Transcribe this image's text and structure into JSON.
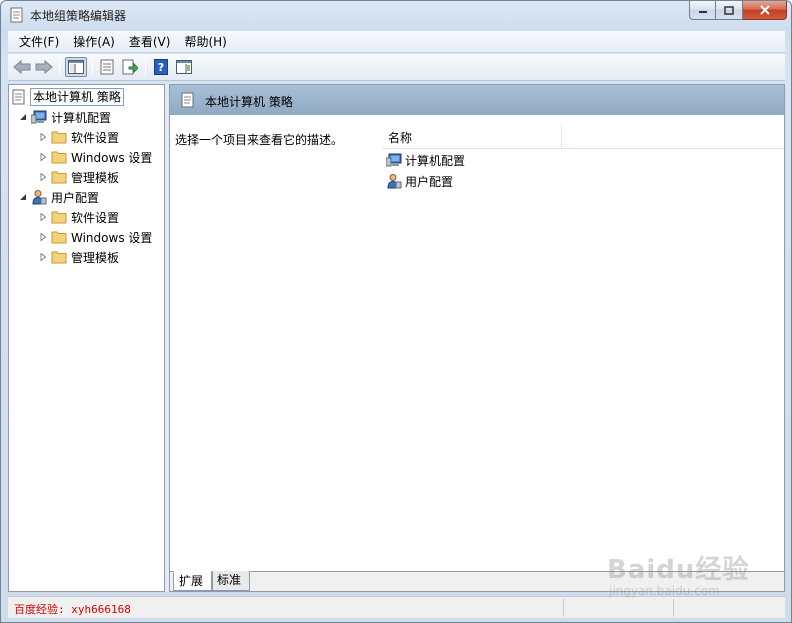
{
  "window": {
    "title": "本地组策略编辑器"
  },
  "menu": [
    {
      "label": "文件(F)"
    },
    {
      "label": "操作(A)"
    },
    {
      "label": "查看(V)"
    },
    {
      "label": "帮助(H)"
    }
  ],
  "tree": {
    "root": "本地计算机 策略",
    "computer": {
      "label": "计算机配置",
      "children": [
        "软件设置",
        "Windows 设置",
        "管理模板"
      ]
    },
    "user": {
      "label": "用户配置",
      "children": [
        "软件设置",
        "Windows 设置",
        "管理模板"
      ]
    }
  },
  "right": {
    "header": "本地计算机 策略",
    "description": "选择一个项目来查看它的描述。",
    "column_name": "名称",
    "items": [
      "计算机配置",
      "用户配置"
    ]
  },
  "tabs": {
    "extended": "扩展",
    "standard": "标准"
  },
  "status": {
    "text": "百度经验: xyh666168"
  },
  "watermark": {
    "main": "Baidu经验",
    "sub": "jingyan.baidu.com"
  },
  "colors": {
    "accent": "#90a9c4",
    "status_text": "#d40000",
    "folder": "#f2d27a"
  }
}
